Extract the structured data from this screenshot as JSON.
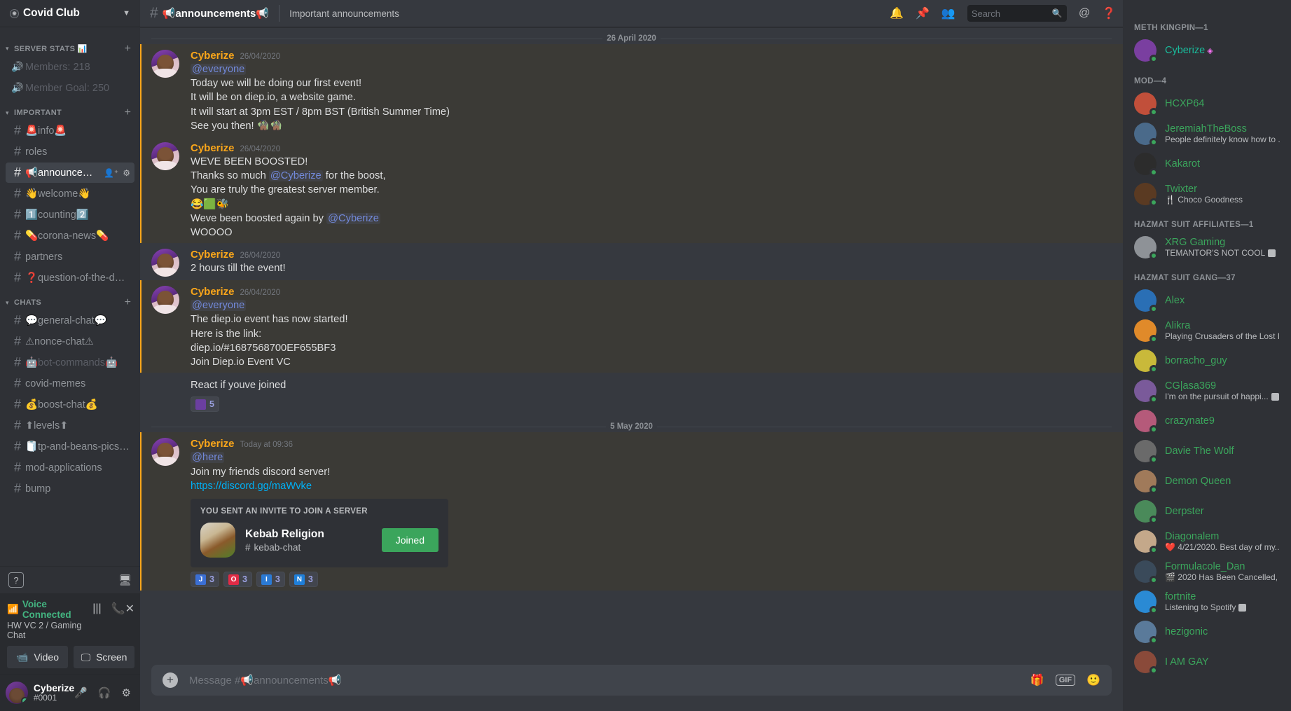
{
  "server": {
    "name": "Covid Club",
    "badge_icon": "circle-icon",
    "chevron_icon": "chevron-down-icon"
  },
  "sidebar": {
    "categories": [
      {
        "name": "SERVER STATS 📊",
        "add_label": "+",
        "channels": [
          {
            "icon": "voice-locked-icon",
            "name": "Members: 218",
            "type": "voice",
            "state": "dim"
          },
          {
            "icon": "voice-locked-icon",
            "name": "Member Goal: 250",
            "type": "voice",
            "state": "dim"
          }
        ]
      },
      {
        "name": "IMPORTANT",
        "add_label": "+",
        "channels": [
          {
            "icon": "hash-icon",
            "name": "🚨info🚨",
            "type": "text",
            "state": "normal"
          },
          {
            "icon": "hash-icon",
            "name": "roles",
            "type": "text",
            "state": "normal"
          },
          {
            "icon": "hash-icon",
            "name": "📢announcements...",
            "type": "text",
            "state": "active",
            "trailing": [
              "add-member-icon",
              "gear-icon"
            ]
          },
          {
            "icon": "hash-icon",
            "name": "👋welcome👋",
            "type": "text",
            "state": "normal"
          },
          {
            "icon": "hash-icon",
            "name": "1️⃣counting2️⃣",
            "type": "text",
            "state": "normal"
          },
          {
            "icon": "hash-icon",
            "name": "💊corona-news💊",
            "type": "text",
            "state": "normal"
          },
          {
            "icon": "hash-icon",
            "name": "partners",
            "type": "text",
            "state": "normal"
          },
          {
            "icon": "hash-icon",
            "name": "❓question-of-the-day❓",
            "type": "text",
            "state": "normal"
          }
        ]
      },
      {
        "name": "CHATS",
        "add_label": "+",
        "channels": [
          {
            "icon": "hash-icon",
            "name": "💬general-chat💬",
            "type": "text",
            "state": "normal"
          },
          {
            "icon": "hash-locked-icon",
            "name": "⚠nonce-chat⚠",
            "type": "text",
            "state": "normal"
          },
          {
            "icon": "hash-icon",
            "name": "🤖bot-commands🤖",
            "type": "text",
            "state": "dim"
          },
          {
            "icon": "hash-icon",
            "name": "covid-memes",
            "type": "text",
            "state": "normal"
          },
          {
            "icon": "hash-icon",
            "name": "💰boost-chat💰",
            "type": "text",
            "state": "normal"
          },
          {
            "icon": "hash-icon",
            "name": "⬆levels⬆",
            "type": "text",
            "state": "normal"
          },
          {
            "icon": "hash-icon",
            "name": "🧻tp-and-beans-pics🧻",
            "type": "text",
            "state": "normal"
          },
          {
            "icon": "hash-icon",
            "name": "mod-applications",
            "type": "text",
            "state": "normal"
          },
          {
            "icon": "hash-icon",
            "name": "bump",
            "type": "text",
            "state": "normal"
          }
        ]
      }
    ],
    "help_label": "?",
    "monitor_icon": "monitor-icon"
  },
  "voice": {
    "status": "Voice Connected",
    "channel": "HW VC 2 / Gaming Chat",
    "signal_icon": "signal-icon",
    "ping_icon": "ping-icon",
    "disconnect_icon": "disconnect-call-icon",
    "video_label": "Video",
    "screen_label": "Screen",
    "video_icon": "camera-icon",
    "screen_icon": "screenshare-icon"
  },
  "user": {
    "name": "Cyberize",
    "tag": "#0001",
    "status": "online",
    "mic_icon": "microphone-icon",
    "headphones_icon": "headphones-icon",
    "settings_icon": "gear-icon"
  },
  "topbar": {
    "hash_icon": "hash-icon",
    "channel_name": "📢announcements📢",
    "topic": "Important announcements",
    "icons": [
      "bell-icon",
      "pin-icon",
      "members-icon",
      "inbox-icon",
      "help-icon"
    ],
    "search_placeholder": "Search",
    "search_icon": "search-icon"
  },
  "messages": {
    "date_divider_1": "26 April 2020",
    "date_divider_2": "5 May 2020",
    "items": [
      {
        "author": "Cyberize",
        "timestamp": "26/04/2020",
        "mention": true,
        "lines": [
          {
            "type": "mention",
            "text": "@everyone"
          },
          {
            "type": "text",
            "text": "Today we will be doing our first event!"
          },
          {
            "type": "text",
            "text": "It will be on diep.io, a website game."
          },
          {
            "type": "text",
            "text": "It will start at 3pm EST / 8pm BST (British Summer Time)"
          },
          {
            "type": "text",
            "text": "See you then! 🧌🧌"
          }
        ]
      },
      {
        "author": "Cyberize",
        "timestamp": "26/04/2020",
        "mention": true,
        "lines": [
          {
            "type": "text",
            "text": "WEVE BEEN BOOSTED!"
          },
          {
            "type": "mix",
            "pre": "Thanks so much ",
            "mention": "@Cyberize",
            "post": " for the boost,"
          },
          {
            "type": "text",
            "text": "You are truly the greatest server member."
          },
          {
            "type": "text",
            "text": "😂🟩🐝"
          },
          {
            "type": "mix",
            "pre": "Weve been boosted again by ",
            "mention": "@Cyberize",
            "post": ""
          },
          {
            "type": "text",
            "text": "WOOOO"
          }
        ]
      },
      {
        "author": "Cyberize",
        "timestamp": "26/04/2020",
        "mention": false,
        "lines": [
          {
            "type": "text",
            "text": "2 hours till the event!"
          }
        ]
      },
      {
        "author": "Cyberize",
        "timestamp": "26/04/2020",
        "mention": true,
        "lines": [
          {
            "type": "mention",
            "text": "@everyone"
          },
          {
            "type": "text",
            "text": "The diep.io event has now started!"
          },
          {
            "type": "text",
            "text": "Here is the link:"
          },
          {
            "type": "text",
            "text": "diep.io/#1687568700EF655BF3"
          },
          {
            "type": "text",
            "text": "Join Diep.io Event VC"
          }
        ]
      },
      {
        "author": "",
        "timestamp": "",
        "mention": false,
        "continuation": true,
        "lines": [
          {
            "type": "text",
            "text": "React if youve joined"
          }
        ],
        "reactions": [
          {
            "emoji": "custom-emoji",
            "count": "5",
            "color": "#6b3fa0"
          }
        ]
      },
      {
        "author": "Cyberize",
        "timestamp": "Today at 09:36",
        "mention": true,
        "lines": [
          {
            "type": "mention",
            "text": "@here"
          },
          {
            "type": "text",
            "text": "Join my friends discord server!"
          },
          {
            "type": "link",
            "text": "https://discord.gg/maWvke"
          }
        ],
        "invite": {
          "header": "YOU SENT AN INVITE TO JOIN A SERVER",
          "server_name": "Kebab Religion",
          "channel": "kebab-chat",
          "hash_icon": "hash-icon",
          "button_label": "Joined",
          "button_color": "#3ba55c"
        },
        "reactions": [
          {
            "emoji": "J",
            "count": "3",
            "color": "#3b6fd4"
          },
          {
            "emoji": "O",
            "count": "3",
            "color": "#e02b45"
          },
          {
            "emoji": "I",
            "count": "3",
            "color": "#2b7ad4"
          },
          {
            "emoji": "N",
            "count": "3",
            "color": "#1f7fd9"
          }
        ]
      }
    ]
  },
  "composer": {
    "plus_icon": "plus-circle-icon",
    "placeholder": "Message #📢announcements📢",
    "gift_icon": "gift-icon",
    "gif_label": "GIF",
    "emoji_icon": "emoji-icon"
  },
  "members": {
    "groups": [
      {
        "title": "METH KINGPIN—1",
        "members": [
          {
            "name": "Cyberize",
            "color": "#1abc9c",
            "status": "online",
            "avatar": "#7a3fa0",
            "subtitle": "",
            "boost": true,
            "boost_icon": "boost-diamond-icon"
          }
        ]
      },
      {
        "title": "MOD—4",
        "members": [
          {
            "name": "HCXP64",
            "color": "#3ba55c",
            "status": "online",
            "avatar": "#c14f3a",
            "subtitle": ""
          },
          {
            "name": "JeremiahTheBoss",
            "color": "#3ba55c",
            "status": "online",
            "avatar": "#4a6a8a",
            "subtitle": "People definitely know how to ...",
            "has_badge": true
          },
          {
            "name": "Kakarot",
            "color": "#3ba55c",
            "status": "online",
            "avatar": "#2c2c2c",
            "subtitle": ""
          },
          {
            "name": "Twixter",
            "color": "#3ba55c",
            "status": "online",
            "avatar": "#5a3a22",
            "subtitle": "🍴 Choco Goodness"
          }
        ]
      },
      {
        "title": "HAZMAT SUIT AFFILIATES—1",
        "members": [
          {
            "name": "XRG Gaming",
            "color": "#3ba55c",
            "status": "online",
            "avatar": "#8e9297",
            "subtitle": "TEMANTOR'S NOT COOL",
            "has_badge": true
          }
        ]
      },
      {
        "title": "HAZMAT SUIT GANG—37",
        "members": [
          {
            "name": "Alex",
            "color": "#3ba55c",
            "status": "online",
            "avatar": "#2a6fb5",
            "subtitle": ""
          },
          {
            "name": "Alikra",
            "color": "#3ba55c",
            "status": "online",
            "avatar": "#e08a2a",
            "subtitle": "Playing Crusaders of the Lost I..."
          },
          {
            "name": "borracho_guy",
            "color": "#3ba55c",
            "status": "online",
            "avatar": "#c9b93a",
            "subtitle": ""
          },
          {
            "name": "CG|asa369",
            "color": "#3ba55c",
            "status": "online",
            "avatar": "#7a5a9a",
            "subtitle": "I'm on the pursuit of happi...",
            "has_badge": true
          },
          {
            "name": "crazynate9",
            "color": "#3ba55c",
            "status": "online",
            "avatar": "#b55a7a",
            "subtitle": ""
          },
          {
            "name": "Davie The Wolf",
            "color": "#3ba55c",
            "status": "online",
            "avatar": "#6a6a6a",
            "subtitle": ""
          },
          {
            "name": "Demon Queen",
            "color": "#3ba55c",
            "status": "online",
            "avatar": "#a07a5a",
            "subtitle": ""
          },
          {
            "name": "Derpster",
            "color": "#3ba55c",
            "status": "online",
            "avatar": "#4a8a5a",
            "subtitle": ""
          },
          {
            "name": "Diagonalem",
            "color": "#3ba55c",
            "status": "online",
            "avatar": "#c4a88a",
            "subtitle": "❤️ 4/21/2020. Best day of my...",
            "has_badge": false
          },
          {
            "name": "Formulacole_Dan",
            "color": "#3ba55c",
            "status": "online",
            "avatar": "#3a4a5a",
            "subtitle": "🎬 2020 Has Been Cancelled, ...",
            "has_badge": true
          },
          {
            "name": "fortnite",
            "color": "#3ba55c",
            "status": "online",
            "avatar": "#2a8ad4",
            "subtitle": "Listening to Spotify",
            "has_badge": true
          },
          {
            "name": "hezigonic",
            "color": "#3ba55c",
            "status": "online",
            "avatar": "#5a7a9a",
            "subtitle": ""
          },
          {
            "name": "I AM GAY",
            "color": "#3ba55c",
            "status": "online",
            "avatar": "#8a4a3a",
            "subtitle": ""
          }
        ]
      }
    ]
  }
}
